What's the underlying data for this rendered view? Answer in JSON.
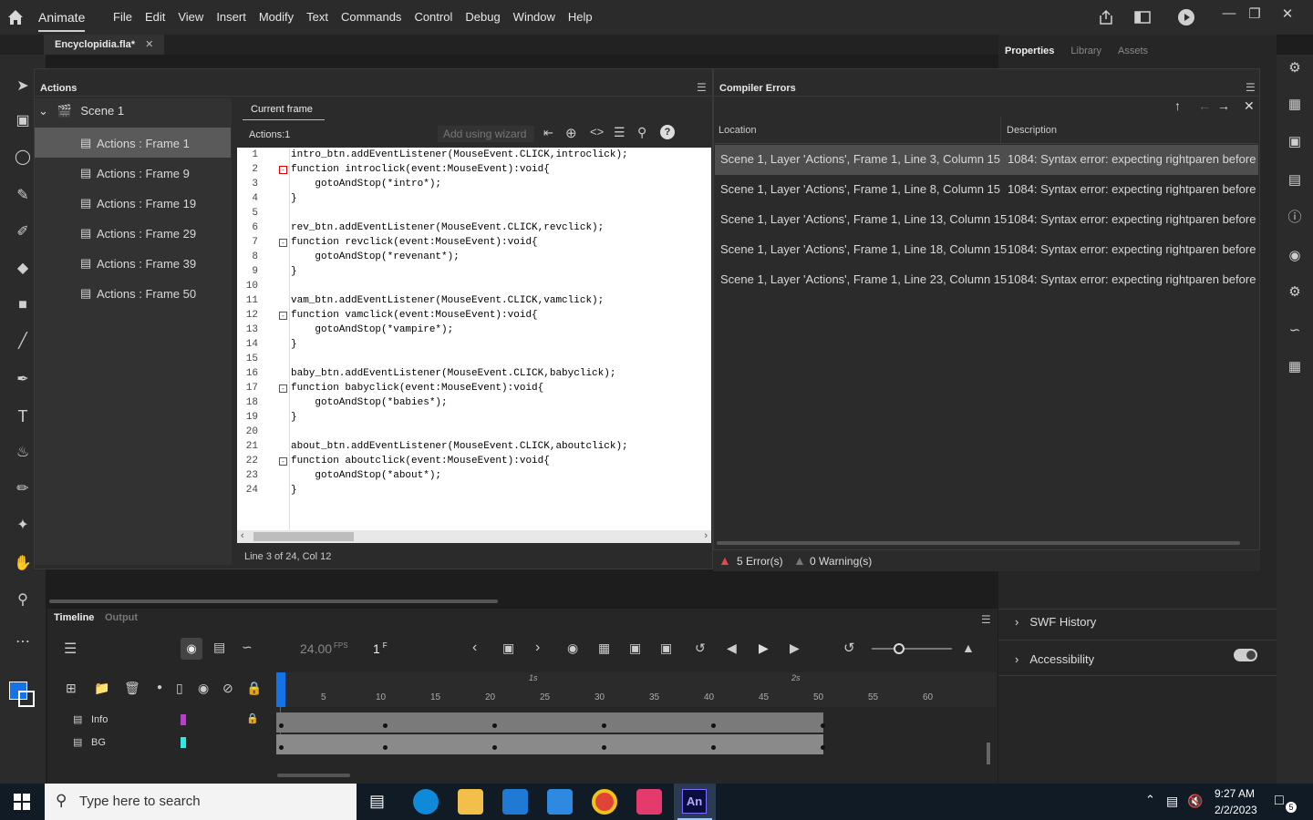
{
  "menubar": {
    "app_name": "Animate",
    "items": [
      "File",
      "Edit",
      "View",
      "Insert",
      "Modify",
      "Text",
      "Commands",
      "Control",
      "Debug",
      "Window",
      "Help"
    ]
  },
  "document_tab": {
    "label": "Encyclopidia.fla*"
  },
  "properties_tabs": [
    "Properties",
    "Library",
    "Assets"
  ],
  "actions_panel": {
    "title": "Actions",
    "scene_label": "Scene 1",
    "frames": [
      "Actions : Frame 1",
      "Actions : Frame 9",
      "Actions : Frame 19",
      "Actions : Frame 29",
      "Actions : Frame 39",
      "Actions : Frame 50"
    ],
    "current_frame_tab": "Current frame",
    "actions_label": "Actions:1",
    "wizard_label": "Add using wizard",
    "status": "Line 3 of 24, Col 12"
  },
  "code_lines": [
    "intro_btn.addEventListener(MouseEvent.CLICK,introclick);",
    "function introclick(event:MouseEvent):void{",
    "    gotoAndStop(*intro*);",
    "}",
    "",
    "rev_btn.addEventListener(MouseEvent.CLICK,revclick);",
    "function revclick(event:MouseEvent):void{",
    "    gotoAndStop(*revenant*);",
    "}",
    "",
    "vam_btn.addEventListener(MouseEvent.CLICK,vamclick);",
    "function vamclick(event:MouseEvent):void{",
    "    gotoAndStop(*vampire*);",
    "}",
    "",
    "baby_btn.addEventListener(MouseEvent.CLICK,babyclick);",
    "function babyclick(event:MouseEvent):void{",
    "    gotoAndStop(*babies*);",
    "}",
    "",
    "about_btn.addEventListener(MouseEvent.CLICK,aboutclick);",
    "function aboutclick(event:MouseEvent):void{",
    "    gotoAndStop(*about*);",
    "}"
  ],
  "compiler_errors": {
    "title": "Compiler Errors",
    "col_location": "Location",
    "col_description": "Description",
    "rows": [
      {
        "location": "Scene 1, Layer 'Actions', Frame 1, Line 3, Column 15",
        "description": "1084: Syntax error: expecting rightparen before"
      },
      {
        "location": "Scene 1, Layer 'Actions', Frame 1, Line 8, Column 15",
        "description": "1084: Syntax error: expecting rightparen before"
      },
      {
        "location": "Scene 1, Layer 'Actions', Frame 1, Line 13, Column 15",
        "description": "1084: Syntax error: expecting rightparen before"
      },
      {
        "location": "Scene 1, Layer 'Actions', Frame 1, Line 18, Column 15",
        "description": "1084: Syntax error: expecting rightparen before"
      },
      {
        "location": "Scene 1, Layer 'Actions', Frame 1, Line 23, Column 15",
        "description": "1084: Syntax error: expecting rightparen before"
      }
    ],
    "error_count": "5 Error(s)",
    "warning_count": "0 Warning(s)"
  },
  "properties_sections": {
    "swf_history": "SWF History",
    "accessibility": "Accessibility"
  },
  "timeline": {
    "tabs": [
      "Timeline",
      "Output"
    ],
    "fps": "24.00",
    "fps_unit": "FPS",
    "current_frame": "1",
    "frame_unit": "F",
    "seconds_labels": [
      "1s",
      "2s"
    ],
    "frame_numbers": [
      "5",
      "10",
      "15",
      "20",
      "25",
      "30",
      "35",
      "40",
      "45",
      "50",
      "55",
      "60"
    ],
    "layers": [
      {
        "name": "Info",
        "color": "#b83fc8"
      },
      {
        "name": "BG",
        "color": "#2ee8e8"
      }
    ]
  },
  "taskbar": {
    "search_placeholder": "Type here to search",
    "time": "9:27 AM",
    "date": "2/2/2023",
    "notification_count": "5",
    "active_app": "An"
  }
}
